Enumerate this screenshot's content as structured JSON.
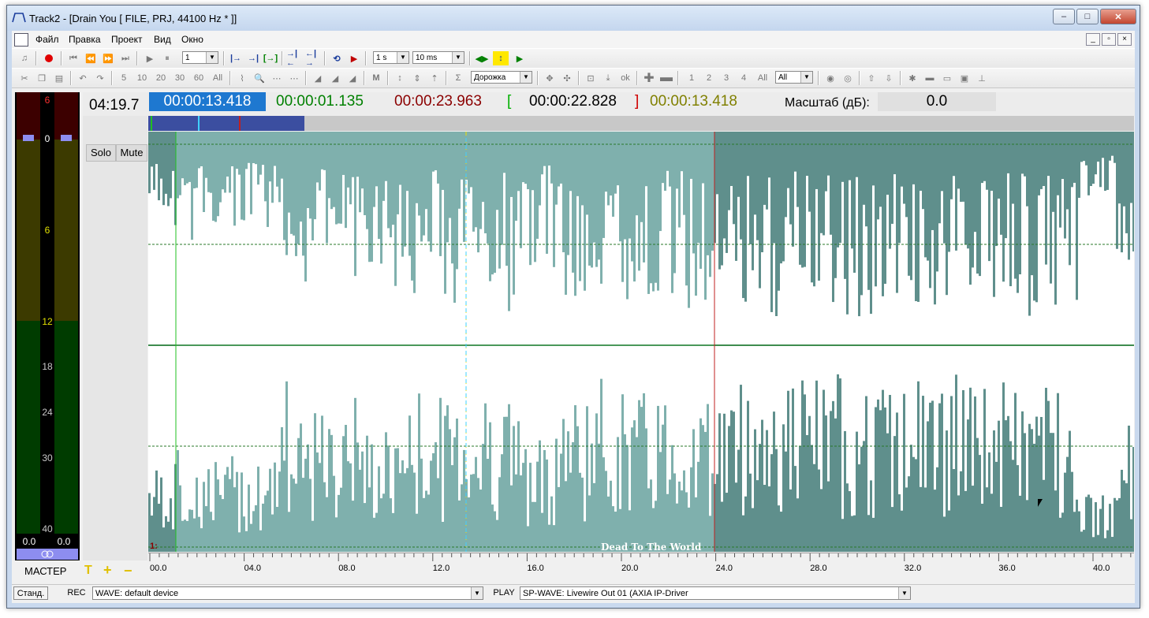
{
  "window": {
    "title": "Track2 - [Drain You [ FILE, PRJ, 44100 Hz * ]]",
    "buttons": {
      "minimize": "–",
      "maximize": "□",
      "close": "✕"
    }
  },
  "menu": [
    "Файл",
    "Правка",
    "Проект",
    "Вид",
    "Окно"
  ],
  "mdi_buttons": [
    "_",
    "▫",
    "×"
  ],
  "toolbar1": {
    "track_count": "1",
    "step_value": "1 s",
    "step_ms": "10 ms"
  },
  "toolbar2": {
    "numbers": [
      "5",
      "10",
      "20",
      "30",
      "60",
      "All"
    ],
    "track_combo": "Дорожка",
    "track_nums": [
      "1",
      "2",
      "3",
      "4",
      "All"
    ],
    "all_combo": "All"
  },
  "timecodes": {
    "duration": "04:19.7",
    "current": "00:00:13.418",
    "sel_length": "00:00:01.135",
    "end_marker": "00:00:23.963",
    "bracket_open": "[",
    "range": "00:00:22.828",
    "bracket_close": "]",
    "cursor": "00:00:13.418",
    "scale_label": "Масштаб (дБ):",
    "scale_value": "0.0"
  },
  "meter": {
    "scale": [
      "6",
      "0",
      "6",
      "12",
      "18",
      "24",
      "30",
      "40"
    ],
    "left_value": "0.0",
    "right_value": "0.0",
    "master_label": "МАСТЕР",
    "colors": {
      "red": "#3c0000",
      "yellow": "#3c3a00",
      "green": "#003c00"
    }
  },
  "track": {
    "solo": "Solo",
    "mute": "Mute",
    "number": "1:",
    "clip_name": "Dead To The World"
  },
  "ruler": {
    "labels": [
      "00.0",
      "04.0",
      "08.0",
      "12.0",
      "16.0",
      "20.0",
      "24.0",
      "28.0",
      "32.0",
      "36.0",
      "40.0"
    ]
  },
  "status": {
    "mode_button": "Станд.",
    "rec_label": "REC",
    "rec_device": "WAVE: default device",
    "play_label": "PLAY",
    "play_device": "SP-WAVE: Livewire Out 01 (AXIA IP-Driver"
  },
  "colors": {
    "wave_fill": "#7fb0ad",
    "wave_dark": "#5f8f8c",
    "time_blue": "#0066cc",
    "time_green": "#008000",
    "time_red": "#8b0000",
    "time_olive": "#808000"
  }
}
